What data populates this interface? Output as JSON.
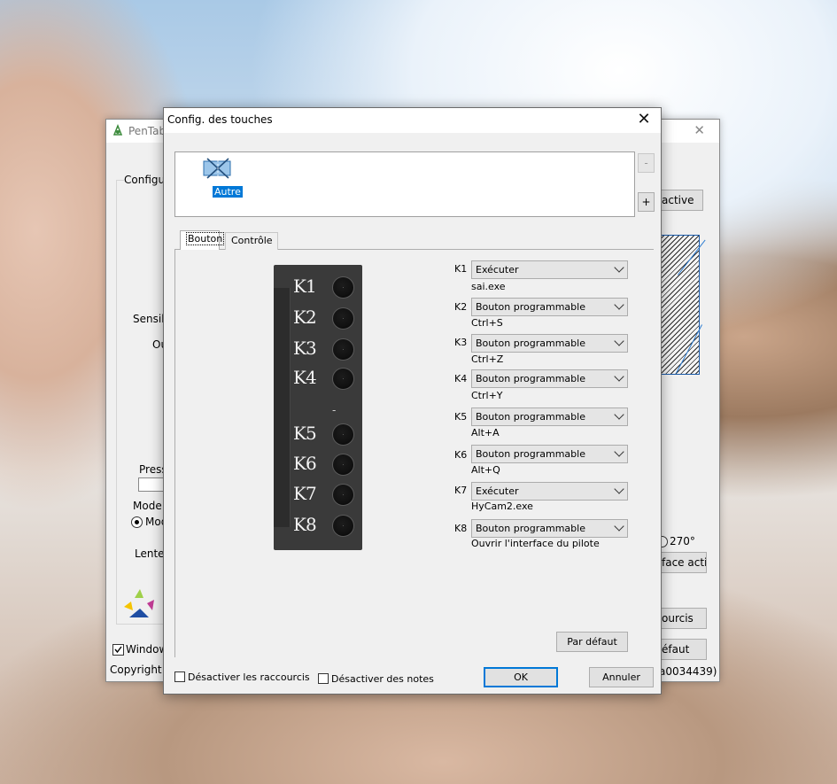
{
  "back_window": {
    "title": "PenTabl",
    "close": "✕",
    "config_label": "Configur",
    "sensib_label": "Sensib",
    "ou_label": "Ou",
    "press_label": "Press",
    "mode_label": "Mode",
    "mode_option": "Mod",
    "lente_label": "Lente",
    "window_check_label": "Window",
    "copyright": "Copyright©",
    "active_btn": "active",
    "rot_270": "270°",
    "face_activ": "face activ",
    "courcis": "ourcis",
    "defaut": "éfaut",
    "version_tail": "a0034439)"
  },
  "dialog": {
    "title": "Config. des touches",
    "close": "✕",
    "app": {
      "label": "Autre",
      "icon": "tablet-app-icon"
    },
    "minus_btn": "-",
    "plus_btn": "+",
    "tabs": [
      "Bouton",
      "Contrôle"
    ],
    "pad_separator": "-",
    "keys": [
      {
        "name": "K1",
        "action": "Exécuter",
        "detail": "sai.exe"
      },
      {
        "name": "K2",
        "action": "Bouton programmable",
        "detail": "Ctrl+S"
      },
      {
        "name": "K3",
        "action": "Bouton programmable",
        "detail": "Ctrl+Z"
      },
      {
        "name": "K4",
        "action": "Bouton programmable",
        "detail": "Ctrl+Y"
      },
      {
        "name": "K5",
        "action": "Bouton programmable",
        "detail": "Alt+A"
      },
      {
        "name": "K6",
        "action": "Bouton programmable",
        "detail": "Alt+Q"
      },
      {
        "name": "K7",
        "action": "Exécuter",
        "detail": "HyCam2.exe"
      },
      {
        "name": "K8",
        "action": "Bouton programmable",
        "detail": "Ouvrir l'interface du pilote"
      }
    ],
    "default_btn": "Par défaut",
    "disable_shortcuts": "Désactiver les raccourcis",
    "disable_notes": "Désactiver des notes",
    "ok": "OK",
    "cancel": "Annuler"
  },
  "colors": {
    "accent": "#0078d7",
    "pad": "#3a3a3a"
  }
}
